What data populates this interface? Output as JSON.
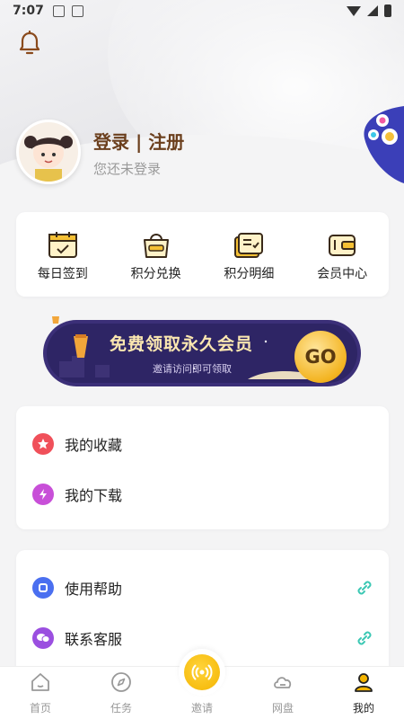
{
  "status_bar": {
    "time": "7:07"
  },
  "profile": {
    "login_label": "登录 | 注册",
    "status_text": "您还未登录"
  },
  "quick_actions": [
    {
      "label": "每日签到",
      "icon": "calendar-check-icon"
    },
    {
      "label": "积分兑换",
      "icon": "shopping-bag-icon"
    },
    {
      "label": "积分明细",
      "icon": "points-detail-icon"
    },
    {
      "label": "会员中心",
      "icon": "wallet-icon"
    }
  ],
  "banner": {
    "title": "免费领取永久会员",
    "subtitle": "邀请访问即可领取",
    "go_label": "GO"
  },
  "list_primary": [
    {
      "label": "我的收藏",
      "icon": "star-icon",
      "color": "#f0505a"
    },
    {
      "label": "我的下载",
      "icon": "lightning-icon",
      "color": "#c84fd8"
    }
  ],
  "list_secondary": [
    {
      "label": "使用帮助",
      "icon": "help-icon",
      "color": "#4a6ff0"
    },
    {
      "label": "联系客服",
      "icon": "chat-icon",
      "color": "#9b4fe0"
    }
  ],
  "tabbar": [
    {
      "label": "首页",
      "icon": "home-icon"
    },
    {
      "label": "任务",
      "icon": "compass-icon"
    },
    {
      "label": "邀请",
      "icon": "broadcast-icon"
    },
    {
      "label": "网盘",
      "icon": "cloud-icon"
    },
    {
      "label": "我的",
      "icon": "profile-icon"
    }
  ],
  "colors": {
    "accent": "#f4b400",
    "brand_brown": "#6b3f1d",
    "link_teal": "#3cc8b4"
  }
}
